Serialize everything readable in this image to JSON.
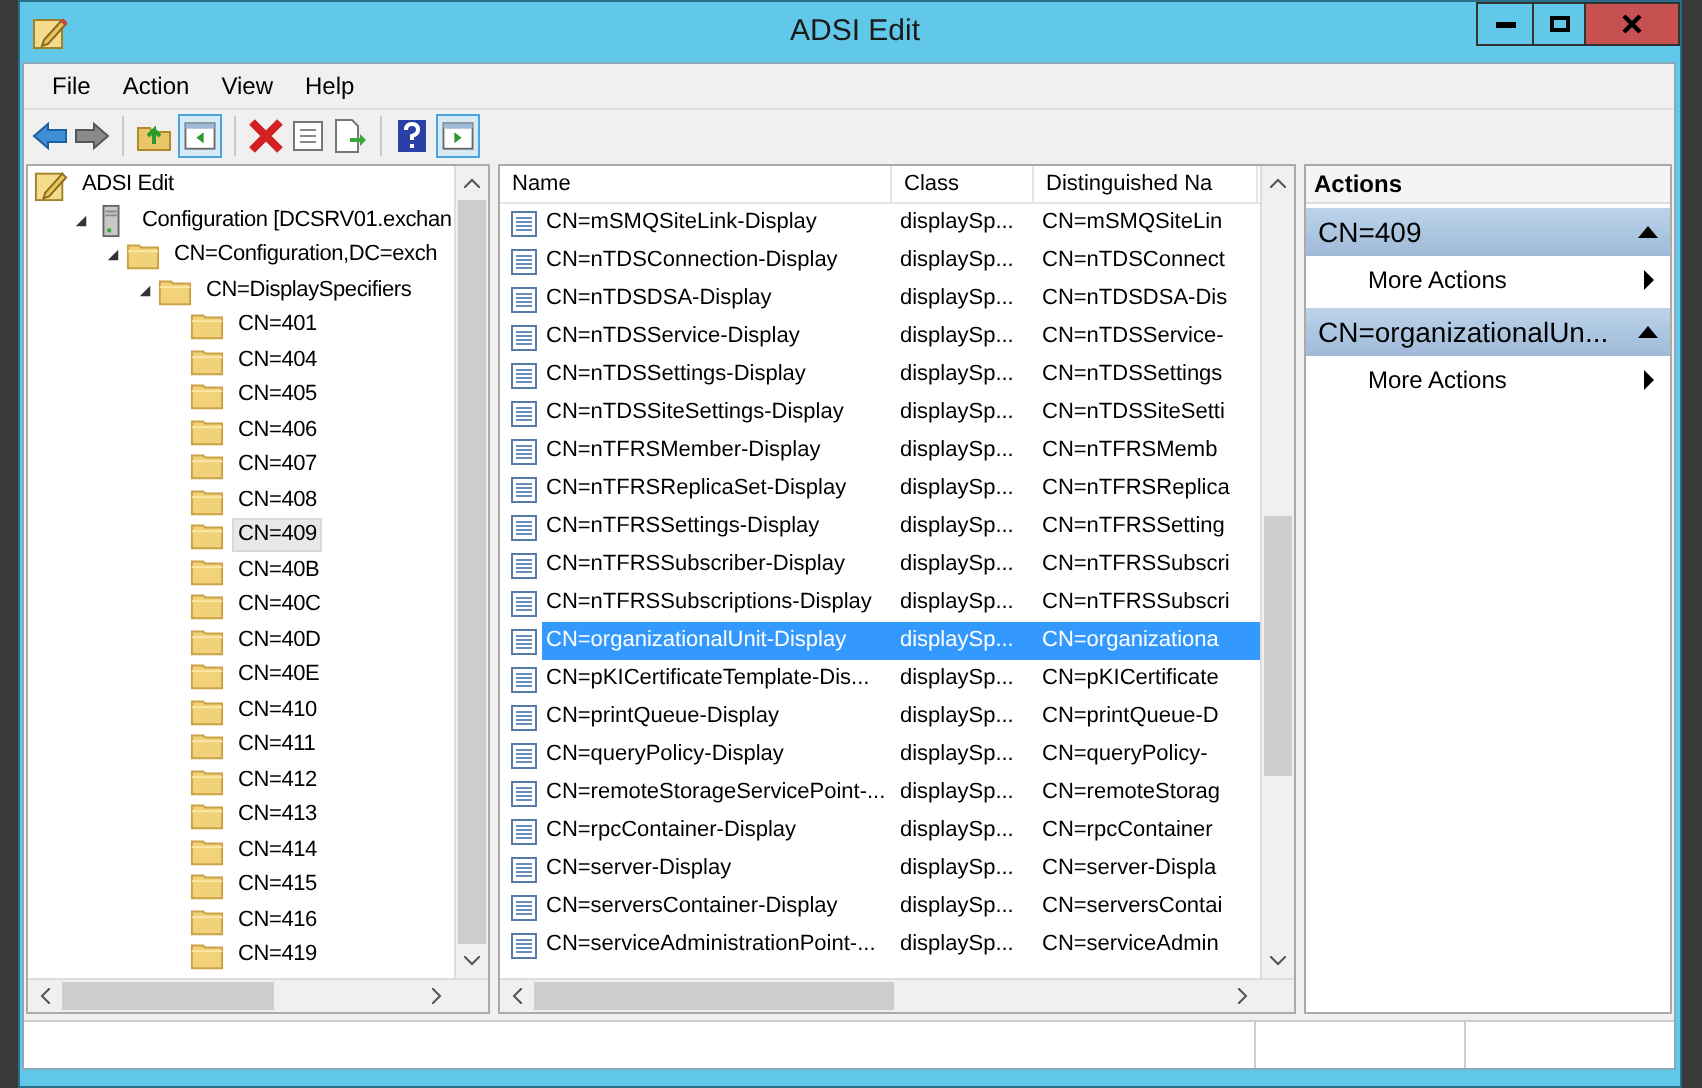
{
  "window": {
    "title": "ADSI Edit"
  },
  "menu": [
    "File",
    "Action",
    "View",
    "Help"
  ],
  "tree": [
    {
      "label": "ADSI Edit",
      "kind": "root",
      "selected": false,
      "children": [
        {
          "label": "Configuration [DCSRV01.exchan",
          "kind": "server",
          "expanded": true,
          "selected": false,
          "children": [
            {
              "label": "CN=Configuration,DC=exch",
              "kind": "folder",
              "expanded": true,
              "selected": false,
              "children": [
                {
                  "label": "CN=DisplaySpecifiers",
                  "kind": "folder",
                  "expanded": true,
                  "selected": false,
                  "children": [
                    {
                      "label": "CN=401",
                      "kind": "folder",
                      "selected": false
                    },
                    {
                      "label": "CN=404",
                      "kind": "folder",
                      "selected": false
                    },
                    {
                      "label": "CN=405",
                      "kind": "folder",
                      "selected": false
                    },
                    {
                      "label": "CN=406",
                      "kind": "folder",
                      "selected": false
                    },
                    {
                      "label": "CN=407",
                      "kind": "folder",
                      "selected": false
                    },
                    {
                      "label": "CN=408",
                      "kind": "folder",
                      "selected": false
                    },
                    {
                      "label": "CN=409",
                      "kind": "folder",
                      "selected": true
                    },
                    {
                      "label": "CN=40B",
                      "kind": "folder",
                      "selected": false
                    },
                    {
                      "label": "CN=40C",
                      "kind": "folder",
                      "selected": false
                    },
                    {
                      "label": "CN=40D",
                      "kind": "folder",
                      "selected": false
                    },
                    {
                      "label": "CN=40E",
                      "kind": "folder",
                      "selected": false
                    },
                    {
                      "label": "CN=410",
                      "kind": "folder",
                      "selected": false
                    },
                    {
                      "label": "CN=411",
                      "kind": "folder",
                      "selected": false
                    },
                    {
                      "label": "CN=412",
                      "kind": "folder",
                      "selected": false
                    },
                    {
                      "label": "CN=413",
                      "kind": "folder",
                      "selected": false
                    },
                    {
                      "label": "CN=414",
                      "kind": "folder",
                      "selected": false
                    },
                    {
                      "label": "CN=415",
                      "kind": "folder",
                      "selected": false
                    },
                    {
                      "label": "CN=416",
                      "kind": "folder",
                      "selected": false
                    },
                    {
                      "label": "CN=419",
                      "kind": "folder",
                      "selected": false
                    }
                  ]
                }
              ]
            }
          ]
        }
      ]
    }
  ],
  "table": {
    "columns": [
      "Name",
      "Class",
      "Distinguished Na"
    ],
    "rows": [
      {
        "name": "CN=mSMQSiteLink-Display",
        "class": "displaySp...",
        "dn": "CN=mSMQSiteLin",
        "selected": false
      },
      {
        "name": "CN=nTDSConnection-Display",
        "class": "displaySp...",
        "dn": "CN=nTDSConnect",
        "selected": false
      },
      {
        "name": "CN=nTDSDSA-Display",
        "class": "displaySp...",
        "dn": "CN=nTDSDSA-Dis",
        "selected": false
      },
      {
        "name": "CN=nTDSService-Display",
        "class": "displaySp...",
        "dn": "CN=nTDSService-",
        "selected": false
      },
      {
        "name": "CN=nTDSSettings-Display",
        "class": "displaySp...",
        "dn": "CN=nTDSSettings",
        "selected": false
      },
      {
        "name": "CN=nTDSSiteSettings-Display",
        "class": "displaySp...",
        "dn": "CN=nTDSSiteSetti",
        "selected": false
      },
      {
        "name": "CN=nTFRSMember-Display",
        "class": "displaySp...",
        "dn": "CN=nTFRSMemb",
        "selected": false
      },
      {
        "name": "CN=nTFRSReplicaSet-Display",
        "class": "displaySp...",
        "dn": "CN=nTFRSReplica",
        "selected": false
      },
      {
        "name": "CN=nTFRSSettings-Display",
        "class": "displaySp...",
        "dn": "CN=nTFRSSetting",
        "selected": false
      },
      {
        "name": "CN=nTFRSSubscriber-Display",
        "class": "displaySp...",
        "dn": "CN=nTFRSSubscri",
        "selected": false
      },
      {
        "name": "CN=nTFRSSubscriptions-Display",
        "class": "displaySp...",
        "dn": "CN=nTFRSSubscri",
        "selected": false
      },
      {
        "name": "CN=organizationalUnit-Display",
        "class": "displaySp...",
        "dn": "CN=organizationa",
        "selected": true
      },
      {
        "name": "CN=pKICertificateTemplate-Dis...",
        "class": "displaySp...",
        "dn": "CN=pKICertificate",
        "selected": false
      },
      {
        "name": "CN=printQueue-Display",
        "class": "displaySp...",
        "dn": "CN=printQueue-D",
        "selected": false
      },
      {
        "name": "CN=queryPolicy-Display",
        "class": "displaySp...",
        "dn": "CN=queryPolicy-",
        "selected": false
      },
      {
        "name": "CN=remoteStorageServicePoint-...",
        "class": "displaySp...",
        "dn": "CN=remoteStorag",
        "selected": false
      },
      {
        "name": "CN=rpcContainer-Display",
        "class": "displaySp...",
        "dn": "CN=rpcContainer",
        "selected": false
      },
      {
        "name": "CN=server-Display",
        "class": "displaySp...",
        "dn": "CN=server-Displa",
        "selected": false
      },
      {
        "name": "CN=serversContainer-Display",
        "class": "displaySp...",
        "dn": "CN=serversContai",
        "selected": false
      },
      {
        "name": "CN=serviceAdministrationPoint-...",
        "class": "displaySp...",
        "dn": "CN=serviceAdmin",
        "selected": false
      }
    ]
  },
  "actions": {
    "title": "Actions",
    "groups": [
      {
        "title": "CN=409",
        "expanded": true,
        "items": [
          "More Actions"
        ]
      },
      {
        "title": "CN=organizationalUn...",
        "expanded": true,
        "items": [
          "More Actions"
        ]
      }
    ]
  }
}
